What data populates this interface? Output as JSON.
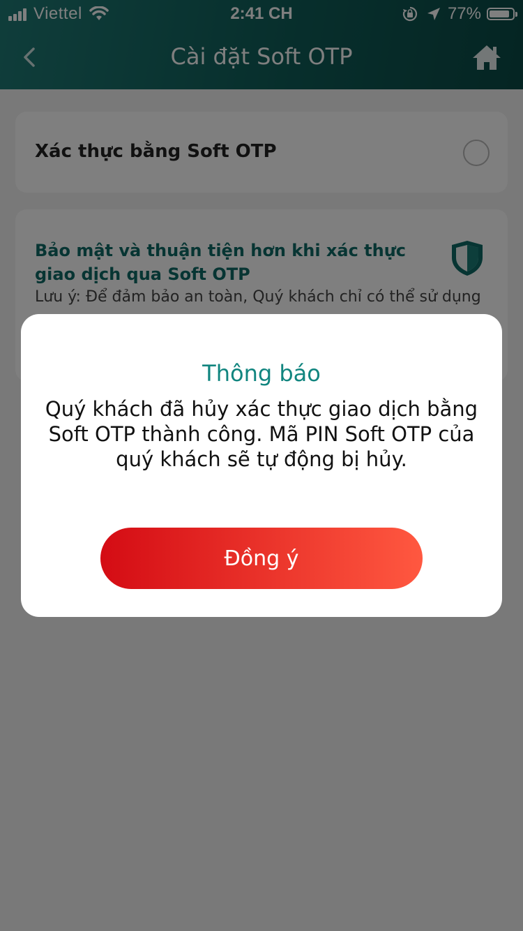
{
  "status_bar": {
    "carrier": "Viettel",
    "time": "2:41 CH",
    "battery_percent": "77%",
    "icons": [
      "signal-icon",
      "wifi-icon",
      "orientation-lock-icon",
      "location-icon",
      "battery-icon"
    ]
  },
  "nav": {
    "title": "Cài đặt Soft OTP",
    "back_icon": "chevron-left-icon",
    "home_icon": "home-icon"
  },
  "settings": {
    "option_label": "Xác thực bằng Soft OTP",
    "info_title": "Bảo mật và thuận tiện hơn khi xác thực giao dịch qua Soft OTP",
    "info_note": "Lưu ý: Để đảm bảo an toàn, Quý khách chỉ có thể sử dụng"
  },
  "dialog": {
    "title": "Thông báo",
    "message": "Quý khách đã hủy xác thực giao dịch bằng Soft OTP thành công. Mã PIN Soft OTP của quý khách sẽ tự động bị hủy.",
    "confirm_label": "Đồng ý"
  },
  "colors": {
    "header_start": "#1f7b76",
    "header_end": "#0a4a46",
    "accent_teal": "#11857f",
    "button_start": "#d40c14",
    "button_end": "#ff5840"
  }
}
